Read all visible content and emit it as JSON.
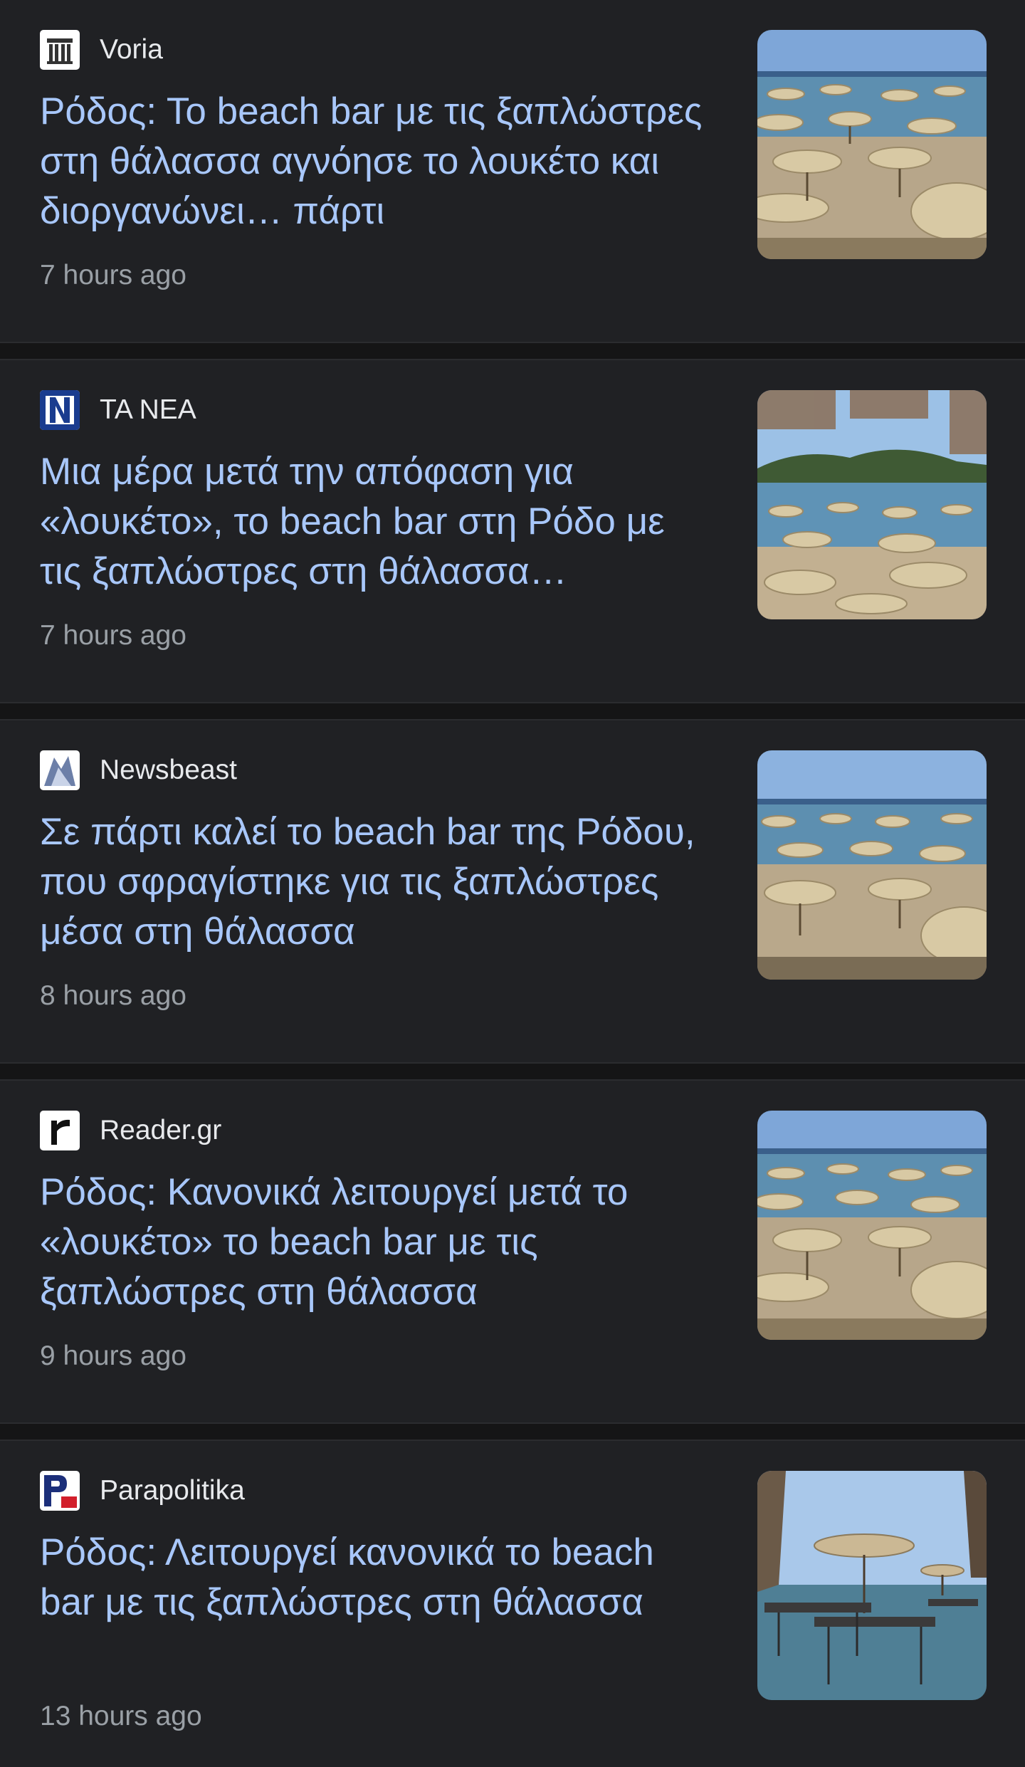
{
  "articles": [
    {
      "source": "Voria",
      "logo_icon": "voria-pillars-icon",
      "headline": "Ρόδος: Το beach bar με τις ξαπλώστρες στη θάλασσα αγνόησε το λουκέτο και διοργανώνει… πάρτι",
      "time": "7 hours ago",
      "thumbnail": "beach-umbrellas-image"
    },
    {
      "source": "ΤΑ ΝΕΑ",
      "logo_icon": "ta-nea-n-icon",
      "headline": "Μια μέρα μετά την απόφαση για «λουκέτο», το beach bar στη Ρόδο με τις ξαπλώστρες στη θάλασσα…",
      "time": "7 hours ago",
      "thumbnail": "beach-umbrellas-island-image"
    },
    {
      "source": "Newsbeast",
      "logo_icon": "newsbeast-icon",
      "headline": "Σε πάρτι καλεί το beach bar της Ρόδου, που σφραγίστηκε για τις ξαπλώστρες μέσα στη θάλασσα",
      "time": "8 hours ago",
      "thumbnail": "beach-umbrellas-image"
    },
    {
      "source": "Reader.gr",
      "logo_icon": "reader-r-icon",
      "headline": "Ρόδος: Κανονικά λειτουργεί μετά το «λουκέτο» το beach bar με τις ξαπλώστρες στη θάλασσα",
      "time": "9 hours ago",
      "thumbnail": "beach-umbrellas-image"
    },
    {
      "source": "Parapolitika",
      "logo_icon": "parapolitika-p-icon",
      "headline": "Ρόδος: Λειτουργεί κανονικά το beach bar με τις ξαπλώστρες στη θάλασσα",
      "time": "13 hours ago",
      "thumbnail": "sunbeds-in-sea-image"
    }
  ]
}
